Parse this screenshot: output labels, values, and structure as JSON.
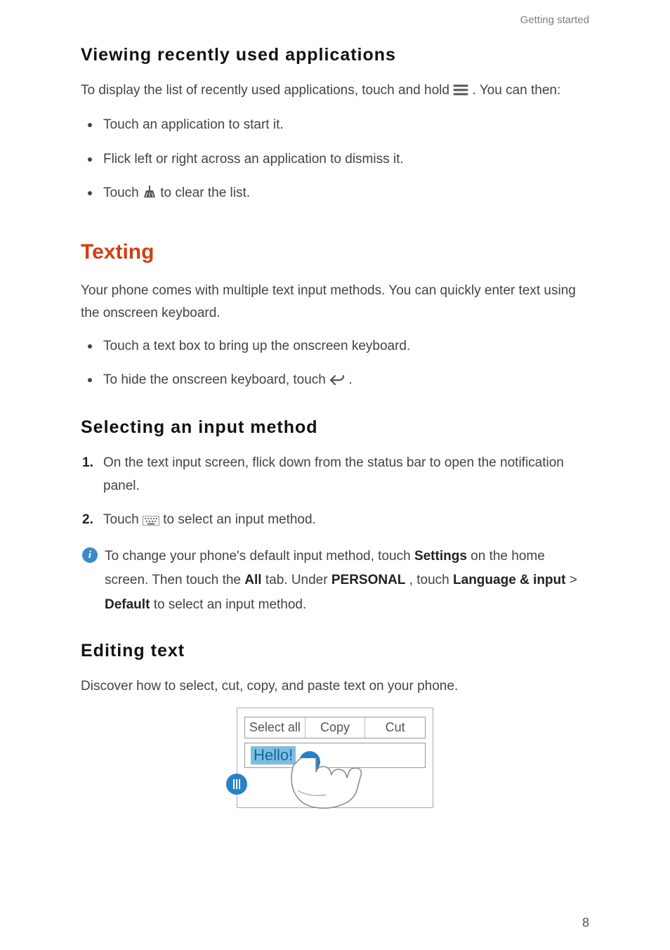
{
  "running_head": "Getting started",
  "page_number": "8",
  "section1": {
    "heading": "Viewing recently used applications",
    "intro_before": "To display the list of recently used applications, touch and hold ",
    "intro_after": " . You can then:",
    "bullets": {
      "b1": "Touch an application to start it.",
      "b2": "Flick left or right across an application to dismiss it.",
      "b3_before": "Touch ",
      "b3_after": " to clear the list."
    }
  },
  "section2": {
    "heading": "Texting",
    "intro": "Your phone comes with multiple text input methods. You can quickly enter text using the onscreen keyboard.",
    "bullets": {
      "b1": "Touch a text box to bring up the onscreen keyboard.",
      "b2_before": "To hide the onscreen keyboard, touch ",
      "b2_after": " ."
    }
  },
  "section3": {
    "heading": "Selecting an input method",
    "steps": {
      "s1": "On the text input screen, flick down from the status bar to open the notification panel.",
      "s2_before": "Touch ",
      "s2_after": " to select an input method."
    },
    "note": {
      "t1": "To change your phone's default input method, touch ",
      "settings": "Settings",
      "t2": " on the home screen. Then touch the ",
      "all": "All",
      "t3": " tab. Under ",
      "personal": "PERSONAL",
      "t4": ", touch ",
      "lang_input": "Language & input",
      "gt": " > ",
      "default": "Default",
      "t5": " to select an input method."
    }
  },
  "section4": {
    "heading": "Editing text",
    "intro": "Discover how to select, cut, copy, and paste text on your phone.",
    "illus": {
      "menu1": "Select all",
      "menu2": "Copy",
      "menu3": "Cut",
      "selection_text": "Hello!"
    }
  }
}
